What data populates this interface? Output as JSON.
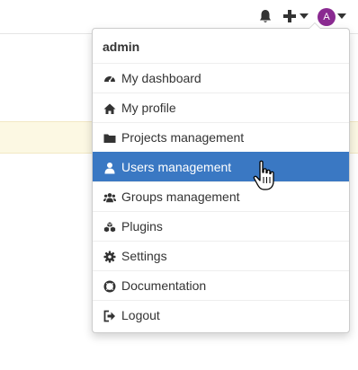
{
  "topbar": {
    "icons": [
      "bell-icon",
      "plus-icon",
      "caret-down-icon",
      "avatar",
      "caret-down-icon"
    ],
    "avatar_letter": "A",
    "avatar_color": "#8a2a91"
  },
  "user_menu": {
    "header": "admin",
    "items": [
      {
        "label": "My dashboard",
        "icon": "dashboard-icon"
      },
      {
        "label": "My profile",
        "icon": "home-icon"
      },
      {
        "label": "Projects management",
        "icon": "folder-icon"
      },
      {
        "label": "Users management",
        "icon": "user-icon",
        "active": true
      },
      {
        "label": "Groups management",
        "icon": "users-icon"
      },
      {
        "label": "Plugins",
        "icon": "cubes-icon"
      },
      {
        "label": "Settings",
        "icon": "gear-icon"
      },
      {
        "label": "Documentation",
        "icon": "life-ring-icon"
      },
      {
        "label": "Logout",
        "icon": "sign-out-icon"
      }
    ],
    "active_color": "#3a78c3"
  },
  "notice_color": "#fcf8e3"
}
